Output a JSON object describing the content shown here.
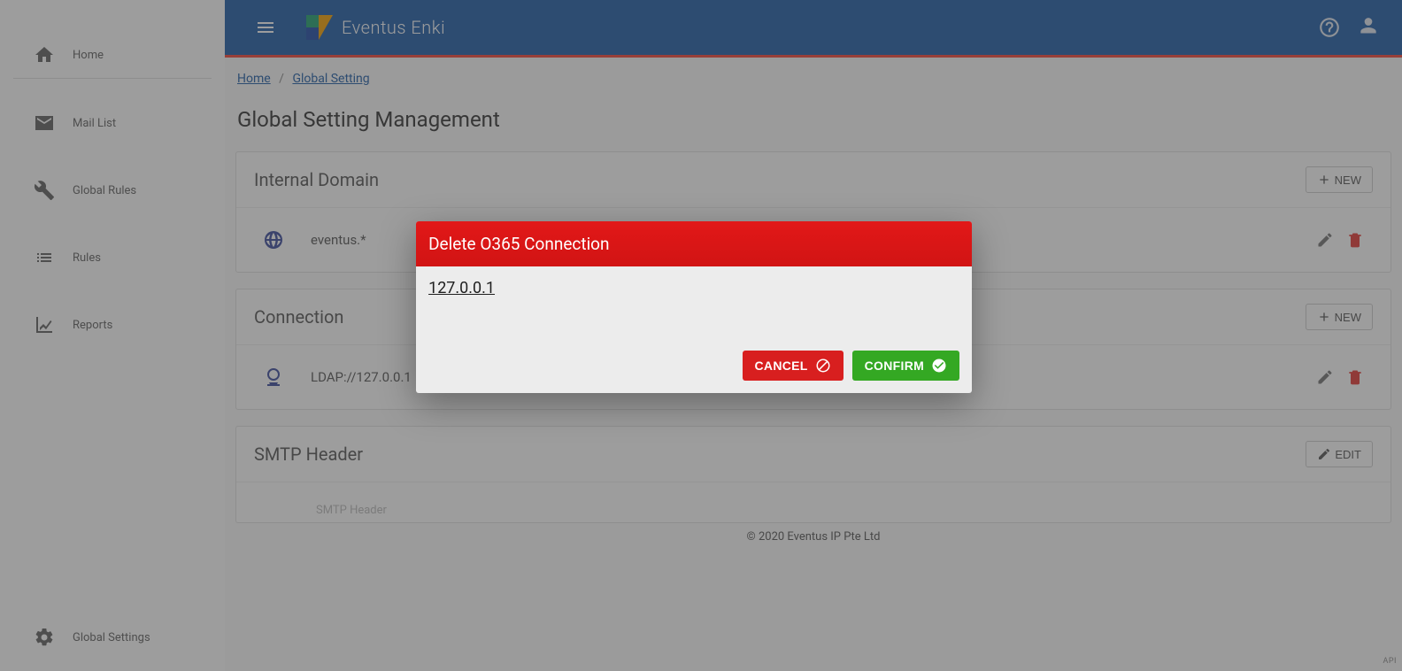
{
  "brand": "Eventus Enki",
  "sidebar": {
    "items": [
      {
        "label": "Home"
      },
      {
        "label": "Mail List"
      },
      {
        "label": "Global Rules"
      },
      {
        "label": "Rules"
      },
      {
        "label": "Reports"
      }
    ],
    "bottom": {
      "label": "Global Settings"
    }
  },
  "breadcrumb": {
    "home": "Home",
    "current": "Global Setting",
    "sep": "/"
  },
  "page": {
    "title": "Global Setting Management"
  },
  "buttons": {
    "new": "NEW",
    "edit": "EDIT"
  },
  "sections": {
    "internal_domain": {
      "title": "Internal Domain",
      "value": "eventus.*"
    },
    "connection": {
      "title": "Connection",
      "value": "LDAP://127.0.0.1"
    },
    "smtp": {
      "title": "SMTP Header",
      "row_label": "SMTP Header"
    }
  },
  "modal": {
    "title": "Delete O365 Connection",
    "value": "127.0.0.1",
    "cancel": "CANCEL",
    "confirm": "CONFIRM"
  },
  "footer": "© 2020 Eventus IP Pte Ltd",
  "api_badge": "API"
}
